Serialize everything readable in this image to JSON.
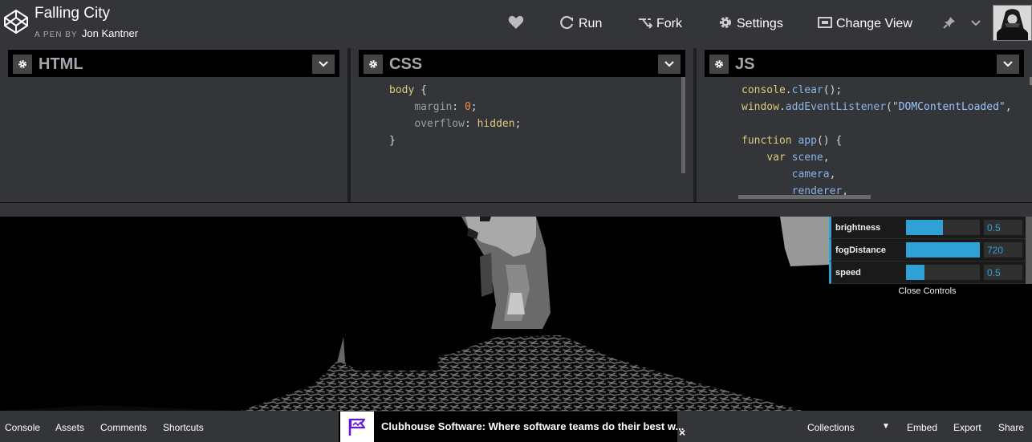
{
  "header": {
    "title": "Falling City",
    "by_label": "A PEN BY",
    "author": "Jon Kantner",
    "run_label": "Run",
    "fork_label": "Fork",
    "settings_label": "Settings",
    "change_view_label": "Change View"
  },
  "editors": {
    "html": {
      "name": "HTML"
    },
    "css": {
      "name": "CSS",
      "lines": [
        {
          "selector": "body",
          "brace": " {"
        },
        {
          "prop": "margin",
          "value": "0",
          "kind": "num"
        },
        {
          "prop": "overflow",
          "value": "hidden",
          "kind": "kw"
        },
        {
          "close": "}"
        }
      ]
    },
    "js": {
      "name": "JS",
      "line1_obj": "console",
      "line1_fn": "clear",
      "line1_tail": "();",
      "line2_obj": "window",
      "line2_fn": "addEventListener",
      "line2_str": "\"DOMContentLoaded\"",
      "line2_tail": ",",
      "line4_kw": "function",
      "line4_fn": "app",
      "line4_tail": "() {",
      "line5_kw": "var",
      "line5_var": "scene",
      "line6_var": "camera",
      "line7_var": "renderer"
    }
  },
  "gui": {
    "controls": [
      {
        "label": "brightness",
        "value": "0.5",
        "fill": 0.5
      },
      {
        "label": "fogDistance",
        "value": "720",
        "fill": 1.0
      },
      {
        "label": "speed",
        "value": "0.5",
        "fill": 0.25
      }
    ],
    "close_label": "Close Controls"
  },
  "footer": {
    "console": "Console",
    "assets": "Assets",
    "comments": "Comments",
    "shortcuts": "Shortcuts",
    "ad_text": "Clubhouse Software: Where software teams do their best w...",
    "ad_close": "×",
    "collections": "Collections",
    "embed": "Embed",
    "export": "Export",
    "share": "Share"
  },
  "colors": {
    "accent": "#2fa1d6",
    "chrome": "#333538",
    "ad_brand": "#6515dd"
  },
  "icons": [
    "codepen-logo-icon",
    "heart-icon",
    "run-icon",
    "fork-icon",
    "settings-icon",
    "change-view-icon",
    "pin-icon",
    "chevron-down-icon",
    "gear-icon",
    "flag-icon",
    "close-icon"
  ]
}
